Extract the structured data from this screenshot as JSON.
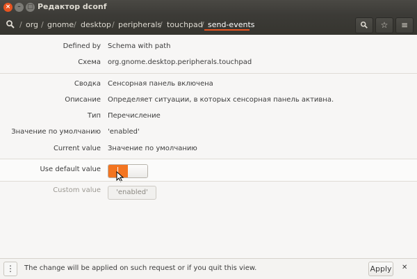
{
  "window": {
    "title": "Редактор dconf",
    "close_glyph": "×",
    "minimize_glyph": "–",
    "maximize_glyph": "□"
  },
  "header": {
    "search_icon": "search-icon",
    "breadcrumb": {
      "separator": "/",
      "items": [
        "org",
        "gnome",
        "desktop",
        "peripherals",
        "touchpad",
        "send-events"
      ]
    },
    "buttons": {
      "search_icon": "search-icon",
      "bookmark_icon": "star-icon",
      "bookmark_glyph": "☆",
      "menu_icon": "hamburger-menu-icon",
      "menu_glyph": "≡"
    },
    "accent_color": "#e95420"
  },
  "properties": {
    "defined_by": {
      "label": "Defined by",
      "value": "Schema with path"
    },
    "schema": {
      "label": "Схема",
      "value": "org.gnome.desktop.peripherals.touchpad"
    },
    "summary": {
      "label": "Сводка",
      "value": "Сенсорная панель включена"
    },
    "description": {
      "label": "Описание",
      "value": "Определяет ситуации, в которых сенсорная панель активна."
    },
    "type": {
      "label": "Тип",
      "value": "Перечисление"
    },
    "default_value": {
      "label": "Значение по умолчанию",
      "value": "'enabled'"
    },
    "current_value": {
      "label": "Current value",
      "value": "Значение по умолчанию"
    }
  },
  "use_default": {
    "label": "Use default value",
    "switch_on": true,
    "switch_mark": "I",
    "switch_color": "#f37521"
  },
  "custom_value": {
    "label": "Custom value",
    "value": "'enabled'"
  },
  "bottom_bar": {
    "menu_glyph": "⋮",
    "message": "The change will be applied on such request or if you quit this view.",
    "apply_label": "Apply",
    "close_glyph": "✕"
  }
}
